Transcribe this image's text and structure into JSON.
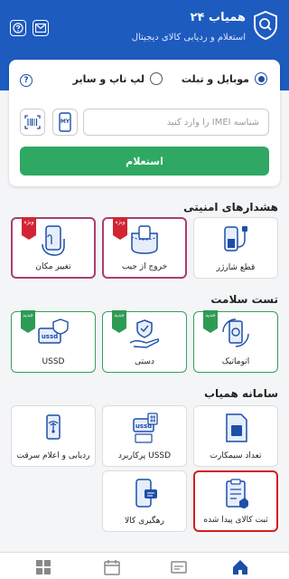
{
  "header": {
    "app_title": "همیاب ۲۴",
    "subtitle": "استعلام و ردیابی کالای دیجیتال",
    "bg_color": "#1d5bbf"
  },
  "search_card": {
    "option_mobile": "موبایل و تبلت",
    "option_laptop": "لپ تاپ و سایر",
    "selected_option": "موبایل و تبلت",
    "imei_placeholder": "شناسه IMEI را وارد کنید",
    "my_button_label": "MY",
    "submit_label": "استعلام",
    "submit_color": "#2ea862"
  },
  "sections": {
    "security_title": "هشدارهای امنیتی",
    "health_title": "تست سلامت",
    "system_title": "سامانه همیاب"
  },
  "security_tiles": [
    {
      "label": "قطع شارژر",
      "badge": ""
    },
    {
      "label": "خروج از جیب",
      "badge": "ویژه"
    },
    {
      "label": "تغییر مکان",
      "badge": "ویژه"
    }
  ],
  "health_tiles": [
    {
      "label": "اتوماتیک",
      "badge": "جدید"
    },
    {
      "label": "دستی",
      "badge": "جدید"
    },
    {
      "label": "USSD",
      "badge": "جدید"
    }
  ],
  "system_tiles": [
    {
      "label": "تعداد سیمکارت"
    },
    {
      "label": "USSD پرکاربرد"
    },
    {
      "label": "ردیابی و اعلام سرقت"
    },
    {
      "label": "ثبت کالای پیدا شده"
    },
    {
      "label": "رهگیری کالا"
    }
  ],
  "ussd_icon_text": "ussd",
  "colors": {
    "accent_blue": "#1d4fa8",
    "maroon_border": "#a8406c",
    "green_border": "#35a05c",
    "selected_border": "#d21f1f"
  }
}
